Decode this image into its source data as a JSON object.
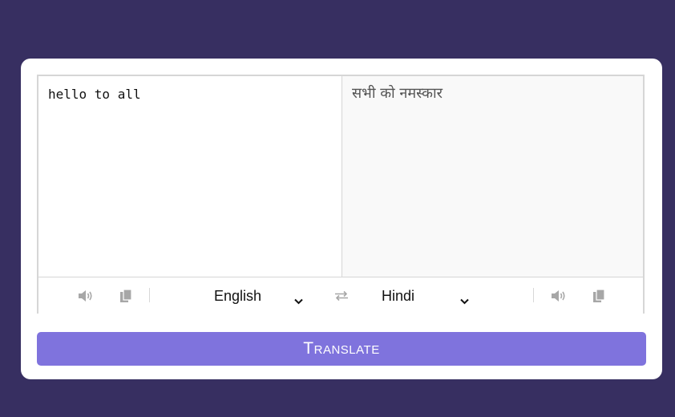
{
  "from_text": {
    "value": "hello to all"
  },
  "to_text": {
    "value": "सभी को नमस्कार"
  },
  "controls": {
    "from_language": "English",
    "to_language": "Hindi",
    "icons": {
      "from_speak": "volume-icon",
      "from_copy": "copy-icon",
      "exchange": "exchange-icon",
      "to_speak": "volume-icon",
      "to_copy": "copy-icon"
    }
  },
  "button": {
    "translate_label": "Translate"
  },
  "colors": {
    "background": "#372f61",
    "card": "#ffffff",
    "button": "#7f73dd",
    "icon": "#a7a7a7"
  }
}
